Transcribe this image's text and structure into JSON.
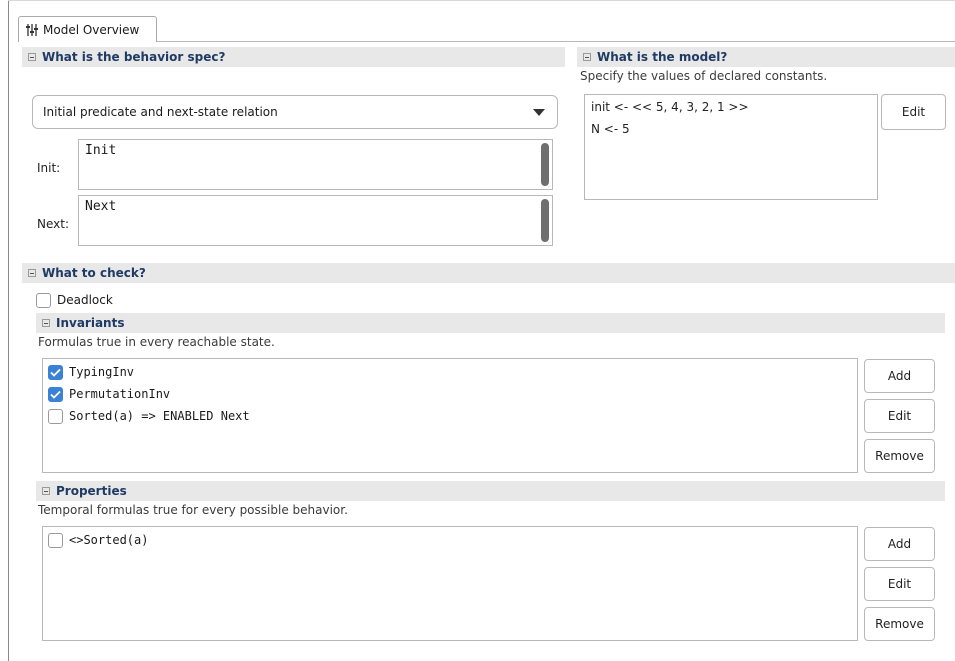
{
  "tab": {
    "label": "Model Overview",
    "icon": "sliders-icon"
  },
  "behavior": {
    "header": "What is the behavior spec?",
    "spec_type": "Initial predicate and next-state relation",
    "init_label": "Init:",
    "init_value": "Init",
    "next_label": "Next:",
    "next_value": "Next"
  },
  "model": {
    "header": "What is the model?",
    "description": "Specify the values of declared constants.",
    "constants": [
      "init <- << 5, 4, 3, 2, 1 >>",
      "N <- 5"
    ],
    "edit_label": "Edit"
  },
  "check": {
    "header": "What to check?",
    "deadlock_label": "Deadlock",
    "deadlock_checked": false
  },
  "invariants": {
    "header": "Invariants",
    "description": "Formulas true in every reachable state.",
    "items": [
      {
        "label": "TypingInv",
        "checked": true
      },
      {
        "label": "PermutationInv",
        "checked": true
      },
      {
        "label": "Sorted(a) => ENABLED Next",
        "checked": false
      }
    ],
    "add_label": "Add",
    "edit_label": "Edit",
    "remove_label": "Remove"
  },
  "properties": {
    "header": "Properties",
    "description": "Temporal formulas true for every possible behavior.",
    "items": [
      {
        "label": "<>Sorted(a)",
        "checked": false
      }
    ],
    "add_label": "Add",
    "edit_label": "Edit",
    "remove_label": "Remove"
  },
  "colors": {
    "header_text": "#1f3a64",
    "check_accent": "#3b82d6",
    "section_bg": "#e8e8e8"
  }
}
